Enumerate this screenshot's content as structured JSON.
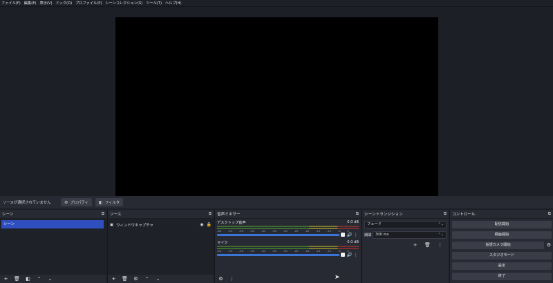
{
  "menu": [
    "ファイル(F)",
    "編集(E)",
    "表示(V)",
    "ドック(D)",
    "プロファイル(P)",
    "シーンコレクション(S)",
    "ツール(T)",
    "ヘルプ(H)"
  ],
  "source_toolbar": {
    "status": "ソースが選択されていません",
    "properties_label": "プロパティ",
    "filters_label": "フィルタ"
  },
  "scenes": {
    "title": "シーン",
    "items": [
      "シーン"
    ]
  },
  "sources": {
    "title": "ソース",
    "items": [
      {
        "label": "ウィンドウキャプチャ",
        "visible": true,
        "locked": false
      }
    ]
  },
  "mixer": {
    "title": "音声ミキサー",
    "scale": [
      "-60",
      "-55",
      "-50",
      "-45",
      "-40",
      "-35",
      "-30",
      "-25",
      "-20",
      "-15",
      "-10",
      "-5",
      "0"
    ],
    "channels": [
      {
        "name": "デスクトップ音声",
        "db": "0.0 dB",
        "level": 1.0
      },
      {
        "name": "マイク",
        "db": "0.0 dB",
        "level": 1.0
      }
    ]
  },
  "transitions": {
    "title": "シーントランジション",
    "selected": "フェード",
    "duration_label": "期間",
    "duration_value": "300 ms"
  },
  "controls": {
    "title": "コントロール",
    "buttons": [
      "配信開始",
      "録画開始",
      "仮想カメラ開始",
      "スタジオモード",
      "設定",
      "終了"
    ]
  },
  "icons": {
    "float": "float-icon",
    "add": "plus-icon",
    "remove": "trash-icon",
    "filter": "filter-icon",
    "up": "chevron-up-icon",
    "down": "chevron-down-icon",
    "gear": "gear-icon",
    "eye": "eye-icon",
    "lock": "lock-icon",
    "volume": "speaker-icon",
    "menu": "kebab-icon"
  },
  "colors": {
    "background": "#1d1f26",
    "panel": "#272a33",
    "selection": "#2f4fbf",
    "fader": "#3a74d6"
  }
}
